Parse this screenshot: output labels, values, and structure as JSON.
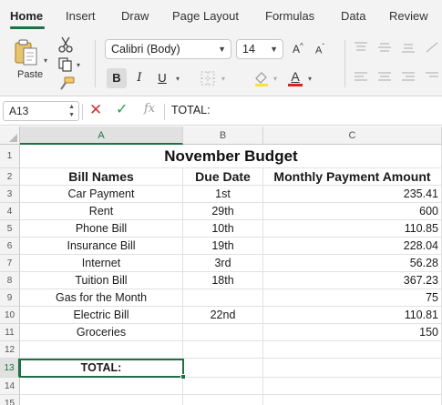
{
  "ribbon": {
    "tabs": [
      "Home",
      "Insert",
      "Draw",
      "Page Layout",
      "Formulas",
      "Data",
      "Review"
    ],
    "paste_label": "Paste",
    "font_name": "Calibri (Body)",
    "font_size": "14",
    "grow_font": "A",
    "shrink_font": "A",
    "bold": "B",
    "italic": "I",
    "underline": "U",
    "font_color_letter": "A"
  },
  "formula_bar": {
    "name_box": "A13",
    "fx": "fx",
    "value": "TOTAL:"
  },
  "columns": [
    "A",
    "B",
    "C"
  ],
  "rows": [
    "1",
    "2",
    "3",
    "4",
    "5",
    "6",
    "7",
    "8",
    "9",
    "10",
    "11",
    "12",
    "13",
    "14",
    "15"
  ],
  "sheet": {
    "title": "November Budget",
    "headers": [
      "Bill Names",
      "Due Date",
      "Monthly Payment Amount"
    ],
    "data": [
      {
        "name": "Car Payment",
        "due": "1st",
        "amount": "235.41"
      },
      {
        "name": "Rent",
        "due": "29th",
        "amount": "600"
      },
      {
        "name": "Phone Bill",
        "due": "10th",
        "amount": "110.85"
      },
      {
        "name": "Insurance Bill",
        "due": "19th",
        "amount": "228.04"
      },
      {
        "name": "Internet",
        "due": "3rd",
        "amount": "56.28"
      },
      {
        "name": "Tuition Bill",
        "due": "18th",
        "amount": "367.23"
      },
      {
        "name": "Gas for the Month",
        "due": "",
        "amount": "75"
      },
      {
        "name": "Electric Bill",
        "due": "22nd",
        "amount": "110.81"
      },
      {
        "name": "Groceries",
        "due": "",
        "amount": "150"
      }
    ],
    "total_label": "TOTAL:"
  },
  "colors": {
    "accent": "#1e7145",
    "cancel": "#d13438",
    "confirm": "#2e9e4a",
    "font_color_bar": "#e02020"
  }
}
